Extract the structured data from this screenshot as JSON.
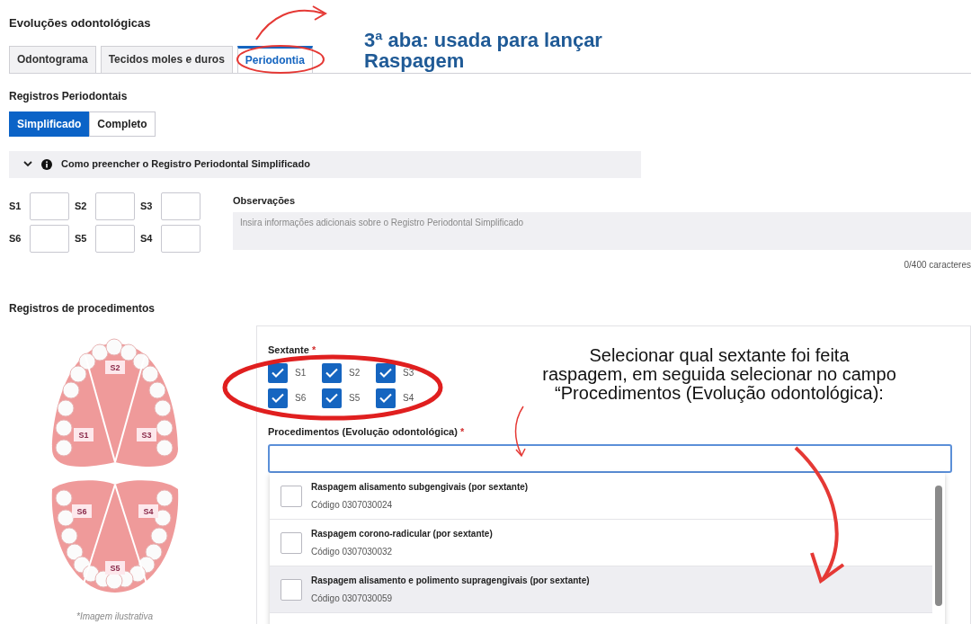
{
  "title": "Evoluções odontológicas",
  "tabs": [
    {
      "label": "Odontograma",
      "selected": false
    },
    {
      "label": "Tecidos moles e duros",
      "selected": false
    },
    {
      "label": "Periodontia",
      "selected": true
    }
  ],
  "periodontal": {
    "heading": "Registros Periodontais",
    "modes": [
      {
        "label": "Simplificado",
        "selected": true
      },
      {
        "label": "Completo",
        "selected": false
      }
    ],
    "help": {
      "label": "Como preencher o Registro Periodontal Simplificado",
      "expanded": false
    },
    "sextants": [
      [
        "S1",
        "S2",
        "S3"
      ],
      [
        "S6",
        "S5",
        "S4"
      ]
    ],
    "notes": {
      "label": "Observações",
      "placeholder": "Insira informações adicionais sobre o Registro Periodontal Simplificado",
      "counter": "0/400 caracteres"
    }
  },
  "procedures": {
    "heading": "Registros de procedimentos",
    "arch_labels": {
      "s2": "S2",
      "s1": "S1",
      "s3": "S3",
      "s6": "S6",
      "s4": "S4",
      "s5": "S5"
    },
    "image_caption": "*Imagem ilustrativa",
    "sextant_label": "Sextante",
    "required_mark": "*",
    "sextant_checks": [
      {
        "label": "S1",
        "checked": true
      },
      {
        "label": "S2",
        "checked": true
      },
      {
        "label": "S3",
        "checked": true
      },
      {
        "label": "S6",
        "checked": true
      },
      {
        "label": "S5",
        "checked": true
      },
      {
        "label": "S4",
        "checked": true
      }
    ],
    "procedure_label": "Procedimentos (Evolução odontológica)",
    "options": [
      {
        "name": "Raspagem alisamento subgengivais (por sextante)",
        "code": "Código 0307030024",
        "checked": false,
        "selected": false
      },
      {
        "name": "Raspagem corono-radicular (por sextante)",
        "code": "Código 0307030032",
        "checked": false,
        "selected": false
      },
      {
        "name": "Raspagem alisamento e polimento supragengivais (por sextante)",
        "code": "Código 0307030059",
        "checked": false,
        "selected": true
      }
    ]
  },
  "annotations": {
    "tab_note": "3ª aba: usada para lançar\nRaspagem",
    "sextant_note": "Selecionar qual sextante foi feita\nraspagem, em seguida selecionar no campo\n“Procedimentos (Evolução odontológica):"
  }
}
